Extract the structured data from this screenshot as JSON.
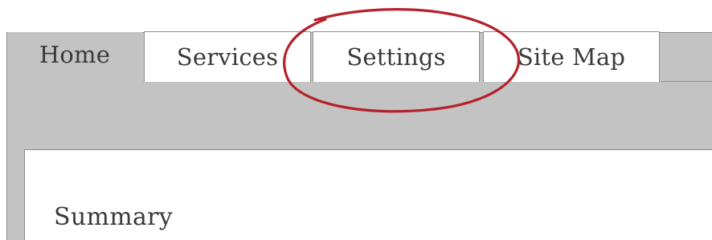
{
  "tabs": [
    {
      "label": "Home",
      "active": true
    },
    {
      "label": "Services",
      "active": false
    },
    {
      "label": "Settings",
      "active": false
    },
    {
      "label": "Site Map",
      "active": false
    }
  ],
  "content": {
    "heading": "Summary"
  },
  "annotation": {
    "shape": "ellipse",
    "color": "#b5202a",
    "target": "Settings"
  },
  "colors": {
    "panel_gray": "#c3c3c3",
    "border": "#8f8f8f",
    "text": "#3a3a3a",
    "background": "#ffffff"
  }
}
